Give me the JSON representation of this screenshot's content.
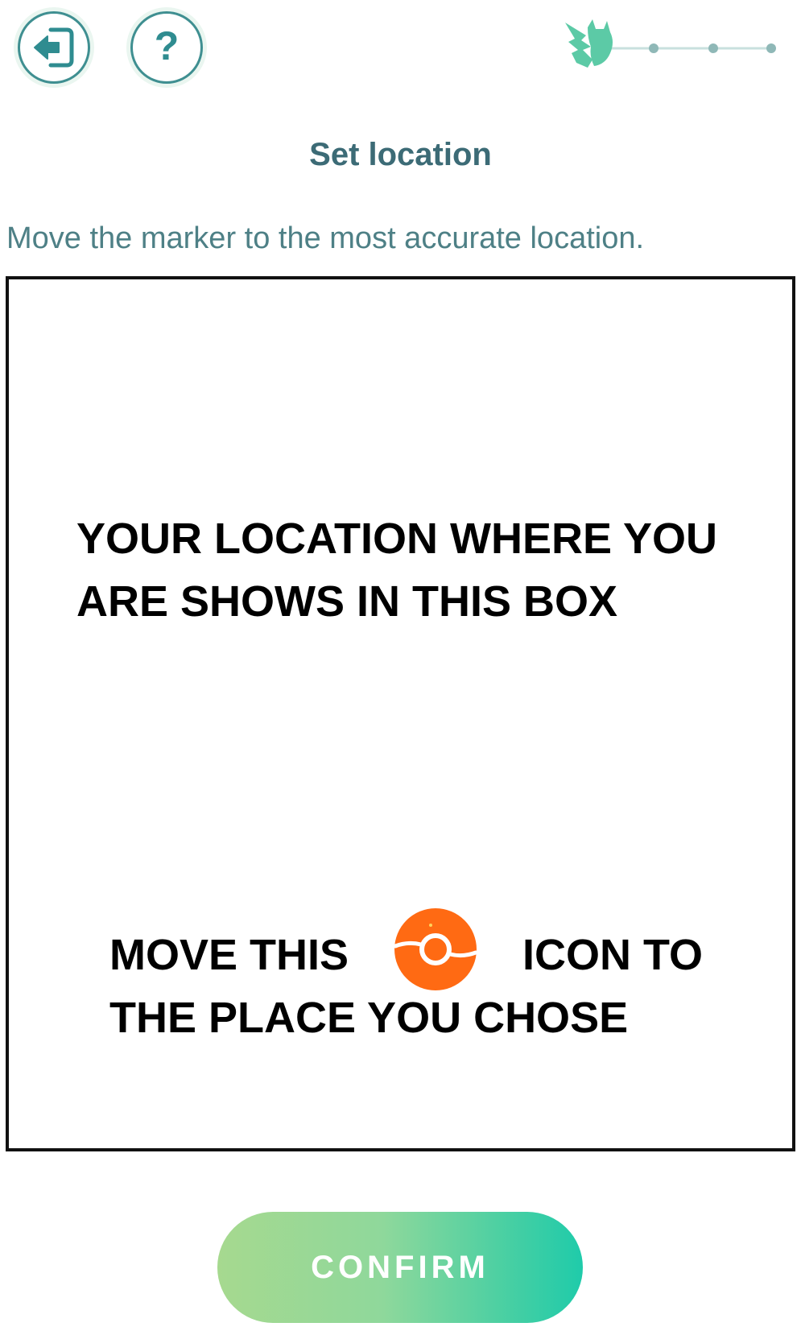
{
  "header": {
    "exit_button_icon": "exit-door-icon",
    "help_button_icon": "question-mark-icon",
    "help_glyph": "?",
    "progress": {
      "icon": "pikachu-silhouette-icon",
      "total_steps": 4,
      "current_step": 1
    }
  },
  "title": "Set location",
  "instruction": "Move the marker to the most accurate location.",
  "map": {
    "line1": "YOUR LOCATION WHERE YOU",
    "line2": "ARE SHOWS IN THIS BOX",
    "line3_prefix": "MOVE THIS",
    "line3_suffix": "ICON TO",
    "line4": "THE PLACE YOU CHOSE",
    "marker_icon": "pokestop-marker-icon"
  },
  "confirm_label": "CONFIRM",
  "colors": {
    "teal": "#3f8f91",
    "title": "#3c6b76",
    "instruction": "#4e8086",
    "marker": "#ff6a13",
    "confirm_start": "#a6d98f",
    "confirm_end": "#1fcbaa"
  }
}
